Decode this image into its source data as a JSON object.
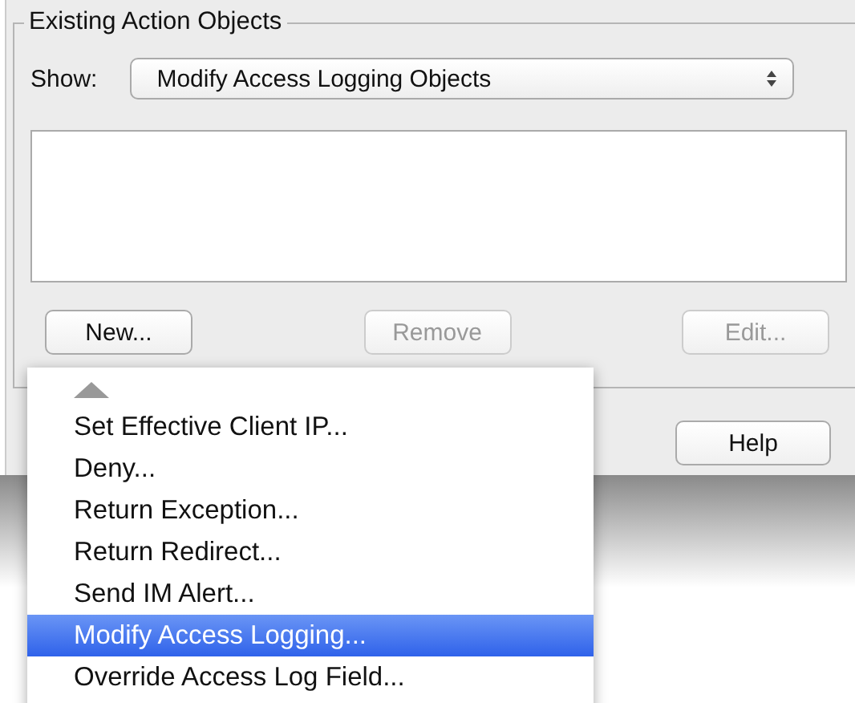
{
  "group": {
    "title": "Existing Action Objects"
  },
  "show": {
    "label": "Show:",
    "value": "Modify Access Logging Objects"
  },
  "buttons": [
    {
      "label": "New...",
      "disabled": false
    },
    {
      "label": "Remove",
      "disabled": true
    },
    {
      "label": "Edit...",
      "disabled": true
    }
  ],
  "help_button": {
    "label": "Help"
  },
  "menu": {
    "items": [
      {
        "label": "Set Effective Client IP...",
        "selected": false
      },
      {
        "label": "Deny...",
        "selected": false
      },
      {
        "label": "Return Exception...",
        "selected": false
      },
      {
        "label": "Return Redirect...",
        "selected": false
      },
      {
        "label": "Send IM Alert...",
        "selected": false
      },
      {
        "label": "Modify Access Logging...",
        "selected": true
      },
      {
        "label": "Override Access Log Field...",
        "selected": false
      }
    ]
  }
}
